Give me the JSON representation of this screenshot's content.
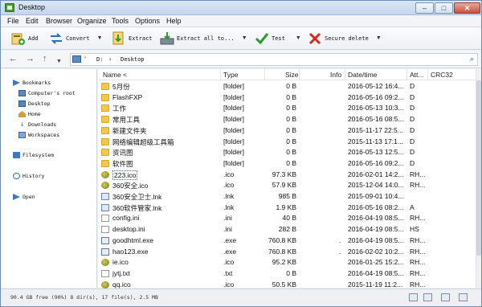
{
  "window": {
    "title": "Desktop"
  },
  "menu": [
    "File",
    "Edit",
    "Browser",
    "Organize",
    "Tools",
    "Options",
    "Help"
  ],
  "toolbar": {
    "add": "Add",
    "convert": "Convert",
    "extract": "Extract",
    "extract_all": "Extract all to...",
    "test": "Test",
    "secure_delete": "Secure delete"
  },
  "address": {
    "drive": "D:",
    "path": "Desktop"
  },
  "left_panel": {
    "bookmarks": "Bookmarks",
    "items": [
      "Computer's root",
      "Desktop",
      "Home",
      "Downloads",
      "Workspaces"
    ],
    "filesystem": "Filesystem",
    "history": "History",
    "open": "Open"
  },
  "columns": {
    "name": "Name <",
    "type": "Type",
    "size": "Size",
    "info": "Info",
    "date": "Date/time",
    "attr": "Att...",
    "crc": "CRC32"
  },
  "files": [
    {
      "name": "5月份",
      "type": "[folder]",
      "size": "0 B",
      "info": "",
      "date": "2016-05-12 16:4...",
      "attr": "D",
      "kind": "folder"
    },
    {
      "name": "FlashFXP",
      "type": "[folder]",
      "size": "0 B",
      "info": "",
      "date": "2016-05-16 09:2...",
      "attr": "D",
      "kind": "folder"
    },
    {
      "name": "工作",
      "type": "[folder]",
      "size": "0 B",
      "info": "",
      "date": "2016-05-13 10:3...",
      "attr": "D",
      "kind": "folder"
    },
    {
      "name": "常用工具",
      "type": "[folder]",
      "size": "0 B",
      "info": "",
      "date": "2016-05-16 08:5...",
      "attr": "D",
      "kind": "folder"
    },
    {
      "name": "新建文件夹",
      "type": "[folder]",
      "size": "0 B",
      "info": "",
      "date": "2015-11-17 22:5...",
      "attr": "D",
      "kind": "folder"
    },
    {
      "name": "网络编辑超级工具箱",
      "type": "[folder]",
      "size": "0 B",
      "info": "",
      "date": "2015-11-13 17:1...",
      "attr": "D",
      "kind": "folder"
    },
    {
      "name": "资讯图",
      "type": "[folder]",
      "size": "0 B",
      "info": "",
      "date": "2016-05-13 12:5...",
      "attr": "D",
      "kind": "folder"
    },
    {
      "name": "软件图",
      "type": "[folder]",
      "size": "0 B",
      "info": "",
      "date": "2016-05-16 09:2...",
      "attr": "D",
      "kind": "folder"
    },
    {
      "name": "223.ico",
      "type": ".ico",
      "size": "97.3 KB",
      "info": "",
      "date": "2016-02-01 14:2...",
      "attr": "RH...",
      "kind": "img"
    },
    {
      "name": "360安全.ico",
      "type": ".ico",
      "size": "57.9 KB",
      "info": "",
      "date": "2015-12-04 14:0...",
      "attr": "RH...",
      "kind": "img"
    },
    {
      "name": "360安全卫士.lnk",
      "type": ".lnk",
      "size": "985 B",
      "info": "",
      "date": "2015-09-01 10:4...",
      "attr": "",
      "kind": "lnk"
    },
    {
      "name": "360软件管家.lnk",
      "type": ".lnk",
      "size": "1.9 KB",
      "info": "",
      "date": "2016-05-16 08:2...",
      "attr": "A",
      "kind": "lnk"
    },
    {
      "name": "config.ini",
      "type": ".ini",
      "size": "40 B",
      "info": "",
      "date": "2016-04-19 08:5...",
      "attr": "RH...",
      "kind": "txt"
    },
    {
      "name": "desktop.ini",
      "type": ".ini",
      "size": "282 B",
      "info": "",
      "date": "2016-04-19 08:5...",
      "attr": "HS",
      "kind": "txt"
    },
    {
      "name": "goodhtml.exe",
      "type": ".exe",
      "size": "760.8 KB",
      "info": ".",
      "date": "2016-04-19 08:5...",
      "attr": "RH...",
      "kind": "exe"
    },
    {
      "name": "hao123.exe",
      "type": ".exe",
      "size": "760.8 KB",
      "info": ".",
      "date": "2016-02-02 10:2...",
      "attr": "RH...",
      "kind": "exe"
    },
    {
      "name": "ie.ico",
      "type": ".ico",
      "size": "95.2 KB",
      "info": "",
      "date": "2016-01-25 15:2...",
      "attr": "RH...",
      "kind": "img"
    },
    {
      "name": "jytj.txt",
      "type": ".txt",
      "size": "0 B",
      "info": "",
      "date": "2016-04-19 08:5...",
      "attr": "RH...",
      "kind": "txt"
    },
    {
      "name": "qq.ico",
      "type": ".ico",
      "size": "50.5 KB",
      "info": "",
      "date": "2015-11-19 11:2...",
      "attr": "RH...",
      "kind": "img"
    }
  ],
  "status": {
    "text": "90.4 GB free (90%)    8 dir(s), 17 file(s), 2.5 MB"
  },
  "icons": {
    "add": "add-archive-icon",
    "convert": "convert-icon",
    "extract": "extract-icon",
    "extract_all": "extract-all-icon",
    "test": "test-checkmark-icon",
    "secure_delete": "secure-delete-x-icon"
  },
  "colors": {
    "accent": "#2f6fb3",
    "folder": "#f2c84b",
    "delete_red": "#d42a1f",
    "test_green": "#2e9a2e"
  }
}
